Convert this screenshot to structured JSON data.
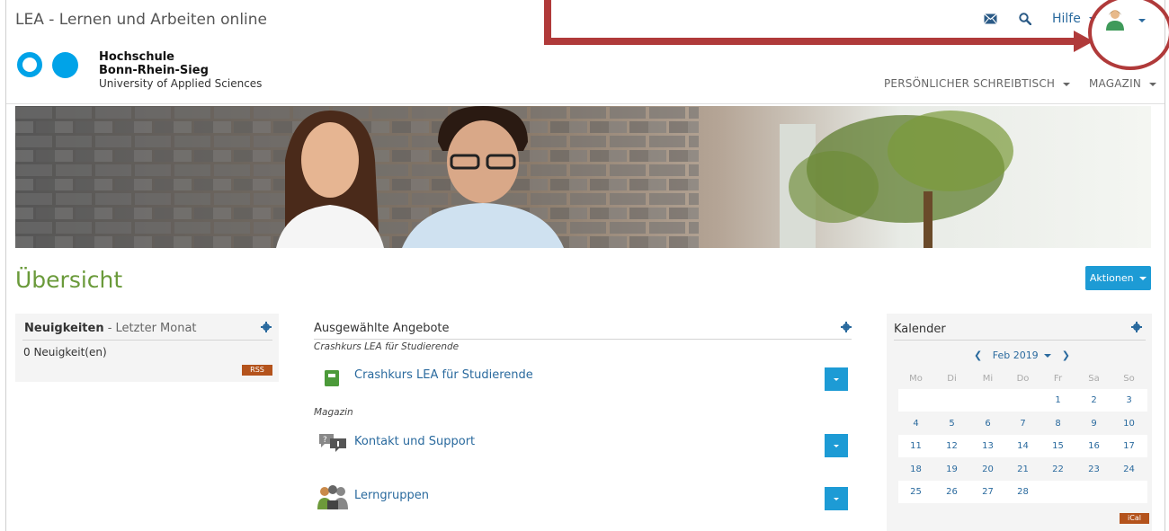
{
  "app": {
    "title": "LEA - Lernen und Arbeiten online"
  },
  "header": {
    "help_label": "Hilfe",
    "icons": {
      "mail": "mail-icon",
      "search": "search-icon",
      "user": "user-avatar-icon"
    }
  },
  "logo": {
    "line1": "Hochschule",
    "line2": "Bonn-Rhein-Sieg",
    "line3": "University of Applied Sciences",
    "color": "#00a3e8"
  },
  "nav": {
    "items": [
      {
        "label": "PERSÖNLICHER SCHREIBTISCH"
      },
      {
        "label": "MAGAZIN"
      }
    ]
  },
  "page": {
    "title": "Übersicht",
    "actions_label": "Aktionen"
  },
  "news": {
    "title": "Neuigkeiten",
    "subtitle": "- Letzter Monat",
    "count_text": "0 Neuigkeit(en)",
    "rss_label": "RSS"
  },
  "featured": {
    "title": "Ausgewählte Angebote",
    "groups": [
      {
        "label": "Crashkurs LEA für Studierende",
        "items": [
          {
            "label": "Crashkurs LEA für Studierende",
            "icon": "course-icon"
          }
        ]
      },
      {
        "label": "Magazin",
        "items": [
          {
            "label": "Kontakt und Support",
            "icon": "forum-icon"
          },
          {
            "label": "Lerngruppen",
            "icon": "group-icon"
          }
        ]
      }
    ]
  },
  "calendar": {
    "title": "Kalender",
    "month_label": "Feb 2019",
    "weekdays": [
      "Mo",
      "Di",
      "Mi",
      "Do",
      "Fr",
      "Sa",
      "So"
    ],
    "weeks": [
      [
        "",
        "",
        "",
        "",
        "1",
        "2",
        "3"
      ],
      [
        "4",
        "5",
        "6",
        "7",
        "8",
        "9",
        "10"
      ],
      [
        "11",
        "12",
        "13",
        "14",
        "15",
        "16",
        "17"
      ],
      [
        "18",
        "19",
        "20",
        "21",
        "22",
        "23",
        "24"
      ],
      [
        "25",
        "26",
        "27",
        "28",
        "",
        "",
        ""
      ]
    ],
    "ical_label": "iCal"
  },
  "colors": {
    "accent_blue": "#1d9bd5",
    "title_green": "#6a9a3a",
    "badge_orange": "#b4531c",
    "annotation_red": "#b03a3a"
  }
}
